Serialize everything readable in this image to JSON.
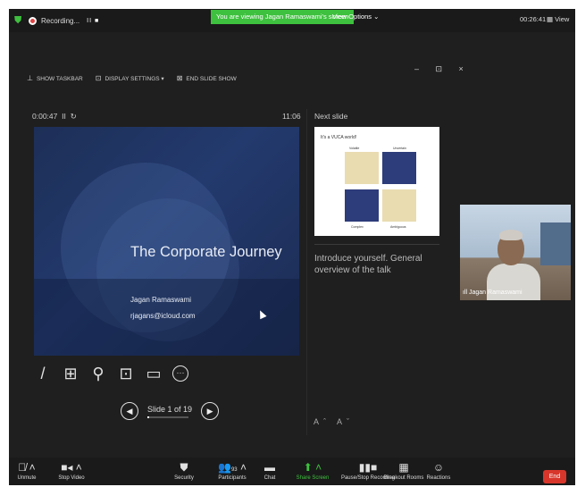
{
  "topbar": {
    "recording_label": "Recording...",
    "recording_controls": "II ■",
    "viewing_banner": "You are viewing Jagan Ramaswami's screen",
    "view_options": "View Options ⌄",
    "meeting_timer": "00:26:41",
    "view_label": "View"
  },
  "presenter_toolbar": {
    "show_taskbar": "SHOW TASKBAR",
    "display_settings": "DISPLAY SETTINGS ▾",
    "end_slide_show": "END SLIDE SHOW",
    "window_controls": "– ⊡ ×"
  },
  "presenter": {
    "elapsed": "0:00:47",
    "pause_icon": "II",
    "reset_icon": "↻",
    "clock": "11:06",
    "slide_counter": "Slide 1 of 19",
    "progress_fraction": 0.0526,
    "next_slide_header": "Next slide",
    "notes": "Introduce yourself. General overview of the talk",
    "font_buttons": "Aˆ Aˇ"
  },
  "current_slide": {
    "title": "The Corporate Journey",
    "name": "Jagan Ramaswami",
    "email": "rjagans@icloud.com"
  },
  "next_slide": {
    "title": "It's a VUCA world!",
    "labels": [
      "Volatile",
      "Uncertain",
      "Complex",
      "Ambiguous"
    ]
  },
  "video": {
    "name": "Jagan Ramaswami",
    "signal_icon": "signal-bars-icon"
  },
  "bottombar": {
    "items": [
      {
        "label": "Unmute",
        "icon": "mic-muted-icon"
      },
      {
        "label": "Stop Video",
        "icon": "video-camera-icon"
      },
      {
        "label": "Security",
        "icon": "shield-icon"
      },
      {
        "label": "Participants",
        "icon": "participants-icon",
        "count": "93"
      },
      {
        "label": "Chat",
        "icon": "chat-icon"
      },
      {
        "label": "Share Screen",
        "icon": "share-screen-icon"
      },
      {
        "label": "Pause/Stop Recording",
        "icon": "recording-icon"
      },
      {
        "label": "Breakout Rooms",
        "icon": "breakout-rooms-icon"
      },
      {
        "label": "Reactions",
        "icon": "reactions-icon"
      }
    ],
    "end_label": "End"
  },
  "colors": {
    "banner_green": "#3ec13e",
    "share_green": "#3ec13e",
    "end_red": "#d9362b",
    "slide_bg": "#1d2f57"
  }
}
